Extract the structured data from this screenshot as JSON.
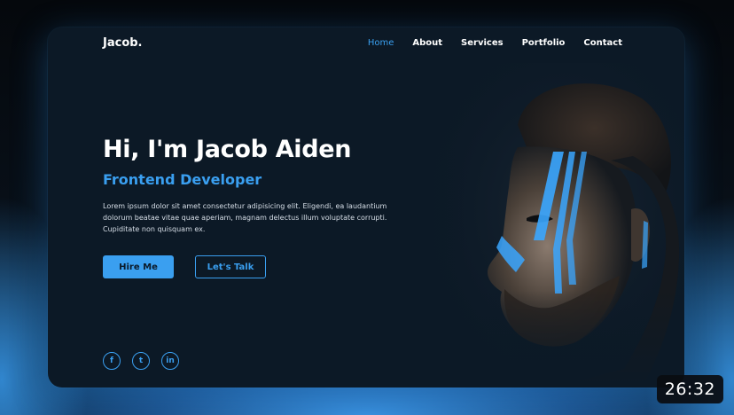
{
  "site": {
    "logo": "Jacob."
  },
  "nav": {
    "items": [
      {
        "label": "Home",
        "active": true
      },
      {
        "label": "About",
        "active": false
      },
      {
        "label": "Services",
        "active": false
      },
      {
        "label": "Portfolio",
        "active": false
      },
      {
        "label": "Contact",
        "active": false
      }
    ]
  },
  "hero": {
    "title": "Hi, I'm Jacob Aiden",
    "subtitle": "Frontend Developer",
    "description": "Lorem ipsum dolor sit amet consectetur adipisicing elit. Eligendi, ea laudantium dolorum beatae vitae quae aperiam, magnam delectus illum voluptate corrupti. Cupiditate non quisquam ex.",
    "primary_button": "Hire Me",
    "secondary_button": "Let's Talk"
  },
  "socials": [
    {
      "name": "facebook-icon",
      "glyph": "f"
    },
    {
      "name": "twitter-icon",
      "glyph": "t"
    },
    {
      "name": "linkedin-icon",
      "glyph": "in"
    }
  ],
  "video": {
    "timestamp": "26:32"
  },
  "colors": {
    "accent": "#3a9ff0",
    "card_bg": "#0c1926",
    "text": "#ffffff"
  }
}
